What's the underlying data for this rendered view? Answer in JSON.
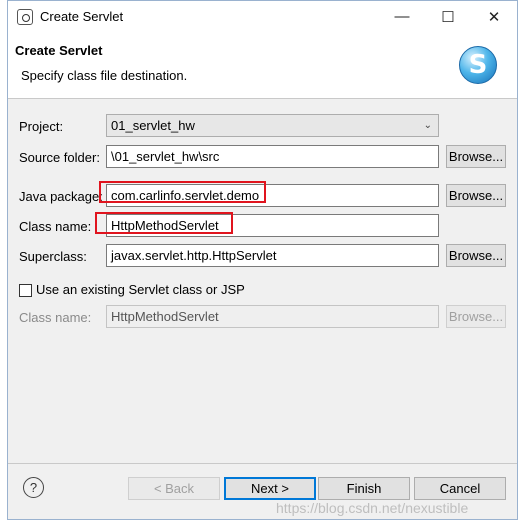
{
  "window": {
    "title": "Create Servlet",
    "controls": {
      "minimize": "—",
      "maximize": "☐",
      "close": "✕"
    }
  },
  "header": {
    "title": "Create Servlet",
    "subtitle": "Specify class file destination.",
    "logo_letter": "S"
  },
  "form": {
    "project": {
      "label": "Project:",
      "value": "01_servlet_hw"
    },
    "source_folder": {
      "label": "Source folder:",
      "value": "\\01_servlet_hw\\src",
      "button": "Browse..."
    },
    "java_package": {
      "label": "Java package:",
      "value": "com.carlinfo.servlet.demo",
      "button": "Browse..."
    },
    "class_name": {
      "label": "Class name:",
      "value": "HttpMethodServlet"
    },
    "superclass": {
      "label": "Superclass:",
      "value": "javax.servlet.http.HttpServlet",
      "button": "Browse..."
    },
    "use_existing": {
      "label": "Use an existing Servlet class or JSP",
      "checked": false
    },
    "existing_class": {
      "label": "Class name:",
      "value": "HttpMethodServlet",
      "button": "Browse..."
    }
  },
  "footer": {
    "help": "?",
    "back": "< Back",
    "next": "Next >",
    "finish": "Finish",
    "cancel": "Cancel"
  },
  "watermark": "https://blog.csdn.net/nexustible",
  "colors": {
    "highlight": "#e0141e",
    "default_button_border": "#0078d7"
  }
}
